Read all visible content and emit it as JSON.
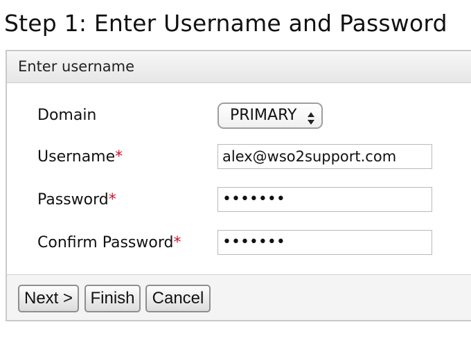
{
  "page": {
    "title": "Step 1: Enter Username and Password"
  },
  "panel": {
    "header": "Enter username",
    "fields": {
      "domain": {
        "label": "Domain",
        "value": "PRIMARY"
      },
      "username": {
        "label": "Username",
        "required_marker": "*",
        "value": "alex@wso2support.com"
      },
      "password": {
        "label": "Password",
        "required_marker": "*",
        "value": "•••••••"
      },
      "confirm_password": {
        "label": "Confirm Password",
        "required_marker": "*",
        "value": "•••••••"
      }
    },
    "buttons": {
      "next": "Next >",
      "finish": "Finish",
      "cancel": "Cancel"
    }
  },
  "icons": {
    "select_arrows": "up-down-arrows-icon"
  },
  "colors": {
    "required": "#d0112b",
    "header_bg": "#e6e6e6",
    "border": "#c9c9c9"
  }
}
